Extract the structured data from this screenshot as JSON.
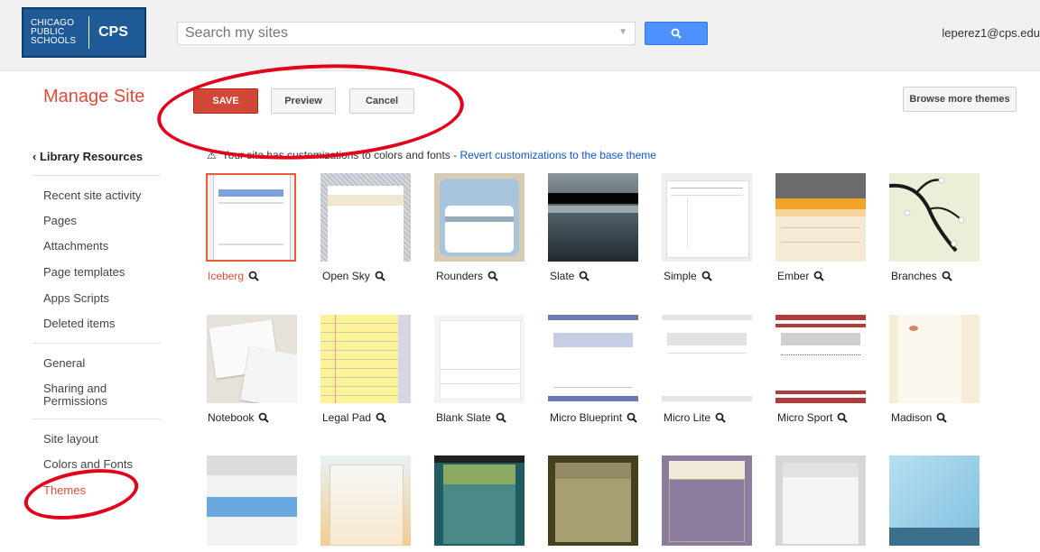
{
  "header": {
    "logo_text": "CHICAGO PUBLIC SCHOOLS",
    "logo_abbr": "CPS",
    "search_placeholder": "Search my sites",
    "user_email": "leperez1@cps.edu"
  },
  "toolbar": {
    "title": "Manage Site",
    "save_label": "SAVE",
    "preview_label": "Preview",
    "cancel_label": "Cancel",
    "browse_label": "Browse more themes"
  },
  "sidebar": {
    "back_label": "Library Resources",
    "group1": [
      "Recent site activity",
      "Pages",
      "Attachments",
      "Page templates",
      "Apps Scripts",
      "Deleted items"
    ],
    "group2": [
      "General",
      "Sharing and Permissions"
    ],
    "group3": [
      "Site layout",
      "Colors and Fonts",
      "Themes"
    ],
    "active": "Themes"
  },
  "notice": {
    "text": "Your site has customizations to colors and fonts - ",
    "link": "Revert customizations to the base theme"
  },
  "themes": {
    "selected": "Iceberg",
    "row1": [
      "Iceberg",
      "Open Sky",
      "Rounders",
      "Slate",
      "Simple",
      "Ember",
      "Branches"
    ],
    "row2": [
      "Notebook",
      "Legal Pad",
      "Blank Slate",
      "Micro Blueprint",
      "Micro Lite",
      "Micro Sport",
      "Madison"
    ]
  },
  "colors": {
    "accent": "#dd4b39",
    "save": "#d14836",
    "search_button": "#4d90fe",
    "annotation": "#e2001a",
    "link": "#1155cc"
  }
}
